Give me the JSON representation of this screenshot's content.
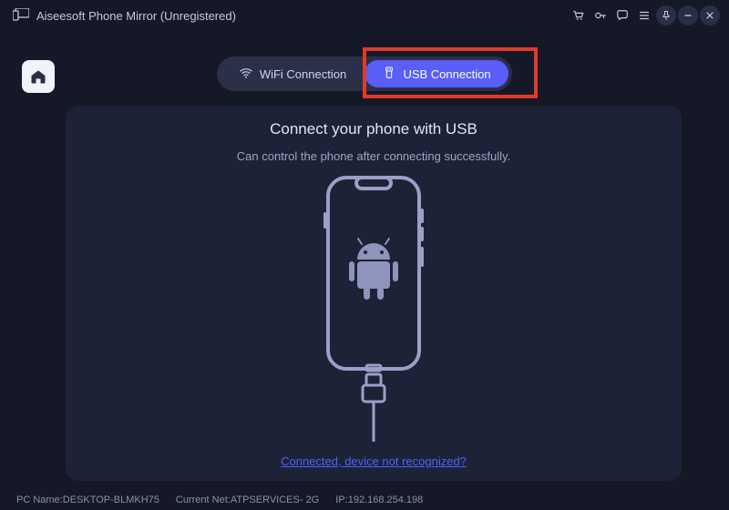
{
  "app": {
    "title": "Aiseesoft Phone Mirror (Unregistered)"
  },
  "titlebar_icons": {
    "cart": "cart-icon",
    "key": "key-icon",
    "chat": "chat-icon",
    "menu": "menu-icon",
    "pin": "pin-icon",
    "minimize": "minimize-icon",
    "close": "close-icon"
  },
  "tabs": {
    "wifi": "WiFi Connection",
    "usb": "USB Connection"
  },
  "panel": {
    "heading": "Connect your phone with USB",
    "sub": "Can control the phone after connecting successfully.",
    "help_link": "Connected, device not recognized?"
  },
  "status": {
    "pc_label": "PC Name:",
    "pc_name": "DESKTOP-BLMKH75",
    "net_label": "Current Net:",
    "net_name": "ATPSERVICES- 2G",
    "ip_label": "IP:",
    "ip": "192.168.254.198"
  },
  "colors": {
    "accent": "#5a5df6",
    "highlight": "#e13a2a",
    "link": "#4a63ff"
  }
}
